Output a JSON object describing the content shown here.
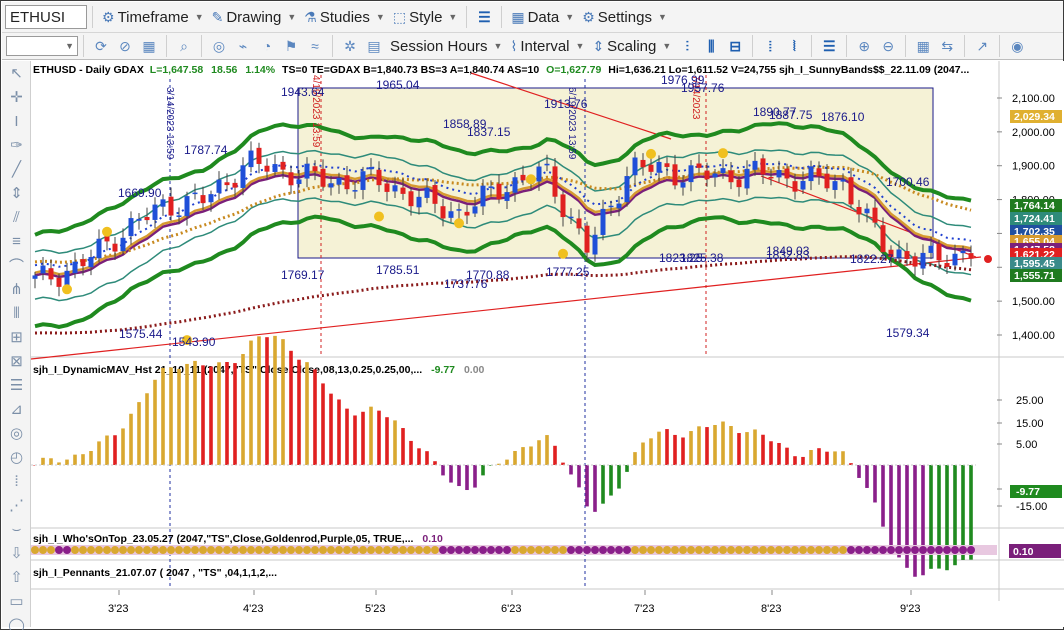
{
  "toolbar1": {
    "symbol": "ETHUSI",
    "timeframe": "Timeframe",
    "drawing": "Drawing",
    "studies": "Studies",
    "style": "Style",
    "data": "Data",
    "settings": "Settings"
  },
  "toolbar2": {
    "session_hours": "Session Hours",
    "interval": "Interval",
    "scaling": "Scaling"
  },
  "header": {
    "symbol_line": "ETHUSD - Daily  GDAX",
    "last": "L=1,647.58",
    "change": "18.56",
    "change_pct": "1.14%",
    "rest1": "TS=0  TE=GDAX  B=1,840.73  BS=3  A=1,840.74  AS=10",
    "open": "O=1,627.79",
    "rest2": "Hi=1,636.21  Lo=1,611.52  V=24,755  sjh_I_SunnyBands$$_22.11.09 (2047..."
  },
  "price_axis": {
    "ticks": [
      "2,100.00",
      "2,000.00",
      "1,900.00",
      "1,800.00",
      "1,700.00",
      "1,600.00",
      "1,500.00",
      "1,400.00"
    ],
    "badges": [
      {
        "text": "2,029.34",
        "bg": "#e0b030",
        "fg": "#ffffff"
      },
      {
        "text": "1,764.14",
        "bg": "#1f7a1f",
        "fg": "#ffffff"
      },
      {
        "text": "1,724.41",
        "bg": "#2e8b7a",
        "fg": "#ffffff"
      },
      {
        "text": "1,702.35",
        "bg": "#2050a0",
        "fg": "#ffffff"
      },
      {
        "text": "1,655.04",
        "bg": "#d69a30",
        "fg": "#ffffff"
      },
      {
        "text": "1,647.58",
        "bg": "#7a1f7a",
        "fg": "#ffffff"
      },
      {
        "text": "1,621.22",
        "bg": "#e02020",
        "fg": "#ffffff"
      },
      {
        "text": "1,595.45",
        "bg": "#3a8a8a",
        "fg": "#ffffff"
      },
      {
        "text": "1,555.71",
        "bg": "#1f7a1f",
        "fg": "#ffffff"
      }
    ]
  },
  "annotations": {
    "date1": "3/14/2023 13:59",
    "date2": "6/19/2023 13:59",
    "date3": "4/19/2023 13:59",
    "date4": "7/14/2023",
    "price_labels": [
      "1943.64",
      "1965.04",
      "1787.74",
      "1669.90",
      "1858.89",
      "1837.15",
      "1913.76",
      "1976.99",
      "1957.76",
      "1890.77",
      "1887.75",
      "1876.10",
      "1700.46",
      "1575.44",
      "1543.90",
      "1769.17",
      "1785.51",
      "1770.88",
      "1737.76",
      "1777.25",
      "1823.25",
      "1825.38",
      "1849.03",
      "1832.83",
      "1822.27",
      "1579.34"
    ]
  },
  "pane2": {
    "title": "sjh_I_DynamicMAV_Hst 21_10_11 (2047,\"TS\",Close,Close,08,13,0.25,0.25,00,...",
    "value1": "-9.77",
    "value2": "0.00",
    "ticks": [
      "25.00",
      "15.00",
      "5.00",
      "-5.00",
      "-15.00"
    ],
    "badge": "-9.77"
  },
  "pane3": {
    "title": "sjh_I_Who'sOnTop_23.05.27 (2047,\"TS\",Close,Goldenrod,Purple,05,  TRUE,...",
    "value": "0.10",
    "badge": "0.10"
  },
  "pane4": {
    "title": "sjh_I_Pennants_21.07.07 (  2047 ,  \"TS\" ,04,1,1,2,..."
  },
  "time_axis": [
    "3'23",
    "4'23",
    "5'23",
    "6'23",
    "7'23",
    "8'23",
    "9'23"
  ],
  "colors": {
    "up": "#1f4fd8",
    "down": "#e02020",
    "green_band": "#1f8a1f",
    "teal_band": "#2e8b7a",
    "purple": "#7a1f7a",
    "gold": "#d69a30",
    "box_fill": "#f5f2d6",
    "box_border": "#1a1a8a"
  },
  "chart_data": {
    "type": "candlestick",
    "symbol": "ETHUSD",
    "interval": "Daily",
    "x": [
      "3'23",
      "4'23",
      "5'23",
      "6'23",
      "7'23",
      "8'23",
      "9'23"
    ],
    "series": [
      {
        "name": "ETHUSD",
        "close_samples": [
          1560,
          1600,
          1700,
          1780,
          1800,
          1910,
          1880,
          1850,
          1860,
          1800,
          1760,
          1840,
          1880,
          1650,
          1900,
          1880,
          1870,
          1880,
          1860,
          1850,
          1650,
          1620,
          1647.58
        ]
      },
      {
        "name": "sjh_I_DynamicMAV_Hst",
        "last": -9.77
      },
      {
        "name": "sjh_I_Who'sOnTop",
        "last": 0.1
      }
    ],
    "ylim": [
      1350,
      2150
    ]
  }
}
